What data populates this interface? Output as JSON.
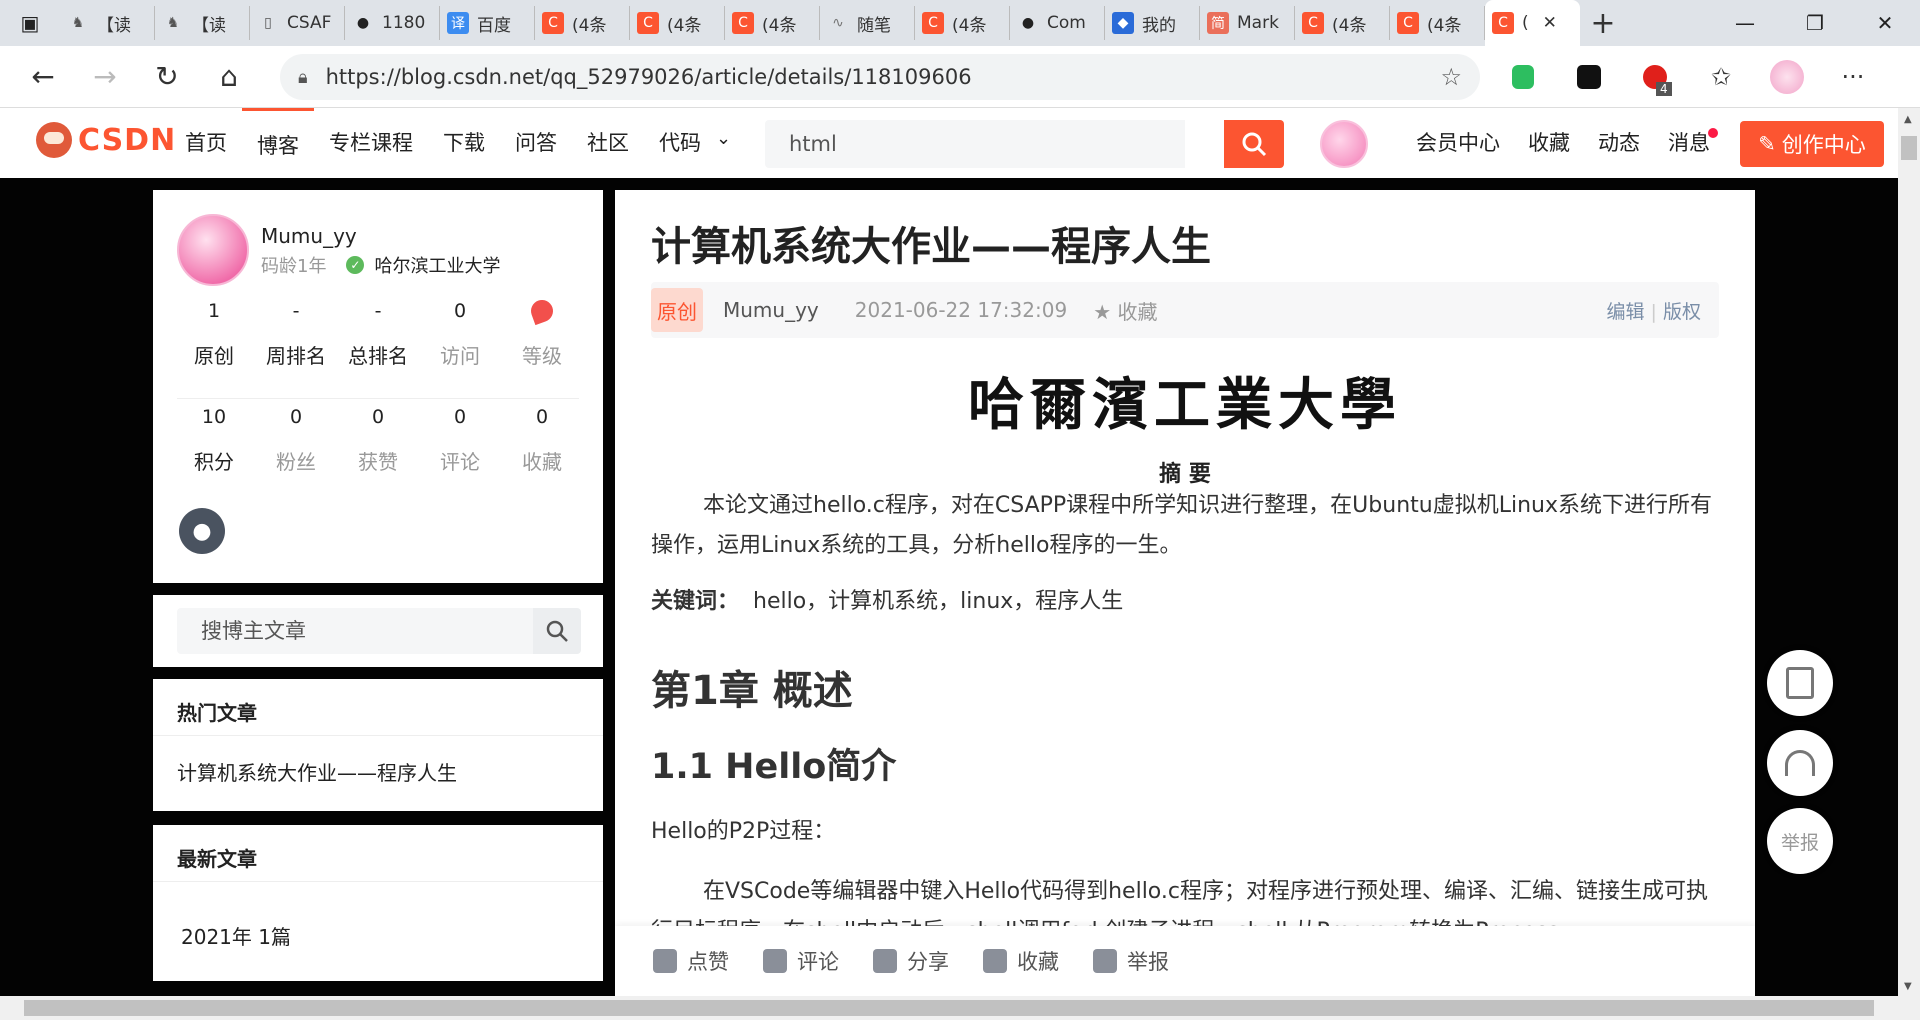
{
  "browser": {
    "tabs": [
      {
        "label": "【读",
        "icon": "horse-icon"
      },
      {
        "label": "【读",
        "icon": "horse-icon"
      },
      {
        "label": "CSAF",
        "icon": "document-icon"
      },
      {
        "label": "1180",
        "icon": "github-icon"
      },
      {
        "label": "百度",
        "icon": "translate-icon"
      },
      {
        "label": "(4条",
        "icon": "csdn-icon"
      },
      {
        "label": "(4条",
        "icon": "csdn-icon"
      },
      {
        "label": "(4条",
        "icon": "csdn-icon"
      },
      {
        "label": "随笔",
        "icon": "cnblogs-icon"
      },
      {
        "label": "(4条",
        "icon": "csdn-icon"
      },
      {
        "label": "Com",
        "icon": "github-icon"
      },
      {
        "label": "我的",
        "icon": "shield-icon"
      },
      {
        "label": "Mark",
        "icon": "jianshu-icon"
      },
      {
        "label": "(4条",
        "icon": "csdn-icon"
      },
      {
        "label": "(4条",
        "icon": "csdn-icon"
      },
      {
        "label": "(",
        "icon": "csdn-icon",
        "active": true
      }
    ],
    "url": "https://blog.csdn.net/qq_52979026/article/details/118109606",
    "ext_badge": "4"
  },
  "csdn": {
    "logo": "CSDN",
    "nav": [
      "首页",
      "博客",
      "专栏课程",
      "下载",
      "问答",
      "社区",
      "代码"
    ],
    "search_placeholder": "html",
    "right_nav": [
      "会员中心",
      "收藏",
      "动态",
      "消息"
    ],
    "create_label": "创作中心"
  },
  "profile": {
    "name": "Mumu_yy",
    "age": "码龄1年",
    "school": "哈尔滨工业大学",
    "stats_row1": [
      {
        "value": "1",
        "label": "原创"
      },
      {
        "value": "-",
        "label": "周排名"
      },
      {
        "value": "-",
        "label": "总排名"
      },
      {
        "value": "0",
        "label": "访问"
      },
      {
        "value": "",
        "label": "等级"
      }
    ],
    "stats_row2": [
      {
        "value": "10",
        "label": "积分"
      },
      {
        "value": "0",
        "label": "粉丝"
      },
      {
        "value": "0",
        "label": "获赞"
      },
      {
        "value": "0",
        "label": "评论"
      },
      {
        "value": "0",
        "label": "收藏"
      }
    ]
  },
  "blog_search": {
    "placeholder": "搜博主文章"
  },
  "hot": {
    "heading": "热门文章",
    "item": "计算机系统大作业——程序人生"
  },
  "newest": {
    "heading": "最新文章",
    "item": "2021年  1篇"
  },
  "article": {
    "title": "计算机系统大作业——程序人生",
    "badge": "原创",
    "author": "Mumu_yy",
    "datetime": "2021-06-22 17:32:09",
    "collect": "收藏",
    "edit": "编辑",
    "sep": "|",
    "copyright": "版权",
    "university": "哈爾濱工業大學",
    "abstract_title": "摘 要",
    "abstract": "本论文通过hello.c程序，对在CSAPP课程中所学知识进行整理，在Ubuntu虚拟机Linux系统下进行所有操作，运用Linux系统的工具，分析hello程序的一生。",
    "keywords_label": "关键词：",
    "keywords": "hello，计算机系统，linux，程序人生",
    "chapter1": "第1章 概述",
    "section11": "1.1 Hello简介",
    "p2p": "Hello的P2P过程：",
    "body": "在VSCode等编辑器中键入Hello代码得到hello.c程序；对程序进行预处理、编译、汇编、链接生成可执行目标程序，在shell中启动后，shell调用fork创建子进程，shell 从Program转换为Process"
  },
  "toolbar": [
    "点赞",
    "评论",
    "分享",
    "收藏",
    "举报"
  ],
  "float": {
    "report": "举报"
  }
}
